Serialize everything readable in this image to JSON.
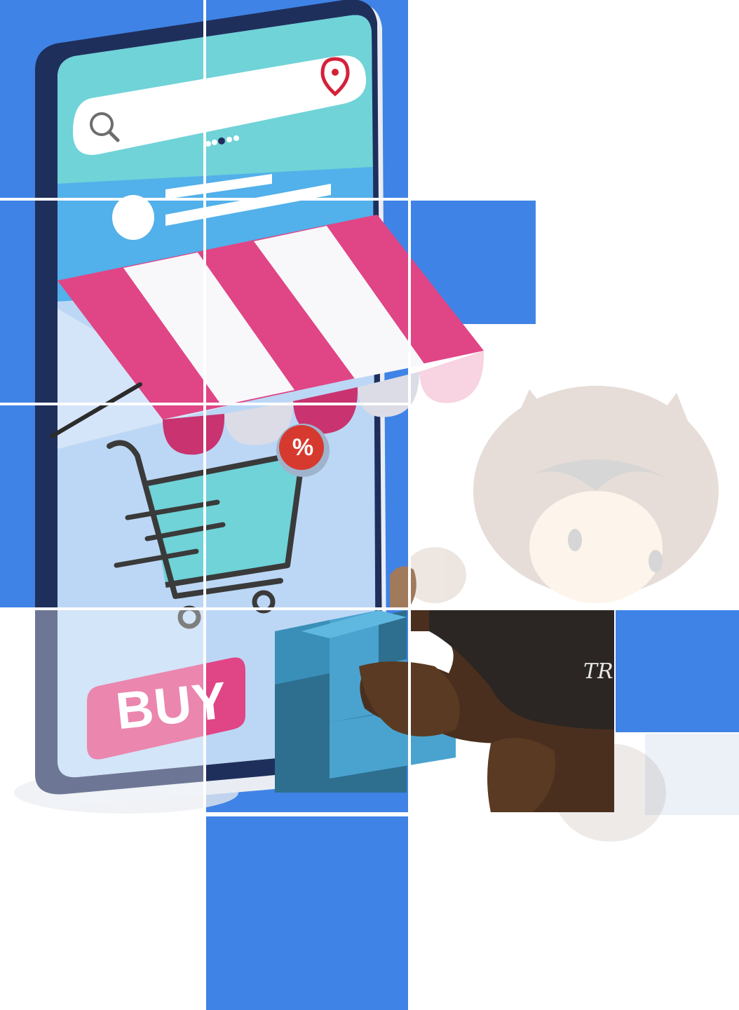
{
  "illustration": {
    "buy_label": "BUY",
    "discount_label": "%",
    "hoodie_label": "TR"
  },
  "colors": {
    "tile_blue": "#3f83e6",
    "awning_pink": "#e04585",
    "screen_teal": "#6fd3d8",
    "phone_navy": "#1f2f5c"
  },
  "icons": [
    "search-icon",
    "location-pin-icon",
    "shopping-cart-icon",
    "discount-badge-icon"
  ]
}
